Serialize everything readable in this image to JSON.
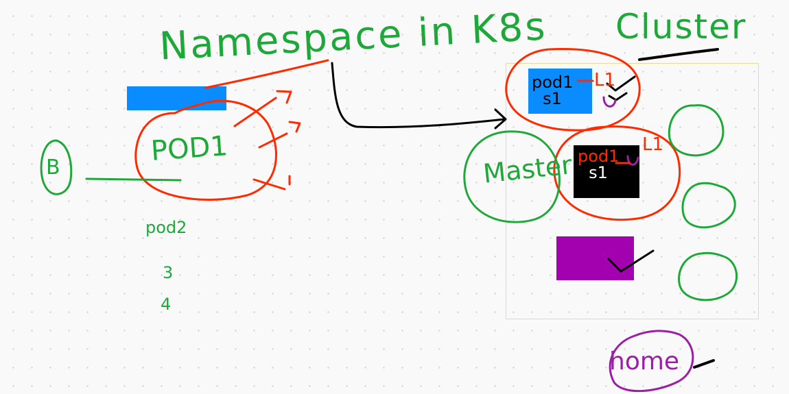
{
  "title": "Namespace in K8s",
  "cluster_label": "Cluster",
  "pod1_label": "POD1",
  "b_label": "B",
  "pod2_label": "pod2",
  "num_3": "3",
  "num_4": "4",
  "master_label": "Master",
  "top_box": {
    "line1": "pod1",
    "line2": "s1",
    "tag": "L1"
  },
  "mid_box": {
    "line1": "pod1",
    "line2": "s1",
    "tag": "L1"
  },
  "home_label": "home",
  "colors": {
    "green": "#1fa83a",
    "red": "#ff2a00",
    "blue_box": "#0a8cff",
    "black_box": "#000000",
    "purple_box": "#a300b0",
    "purple_ink": "#9b1fa6",
    "cluster_border": "#f3d98a"
  }
}
